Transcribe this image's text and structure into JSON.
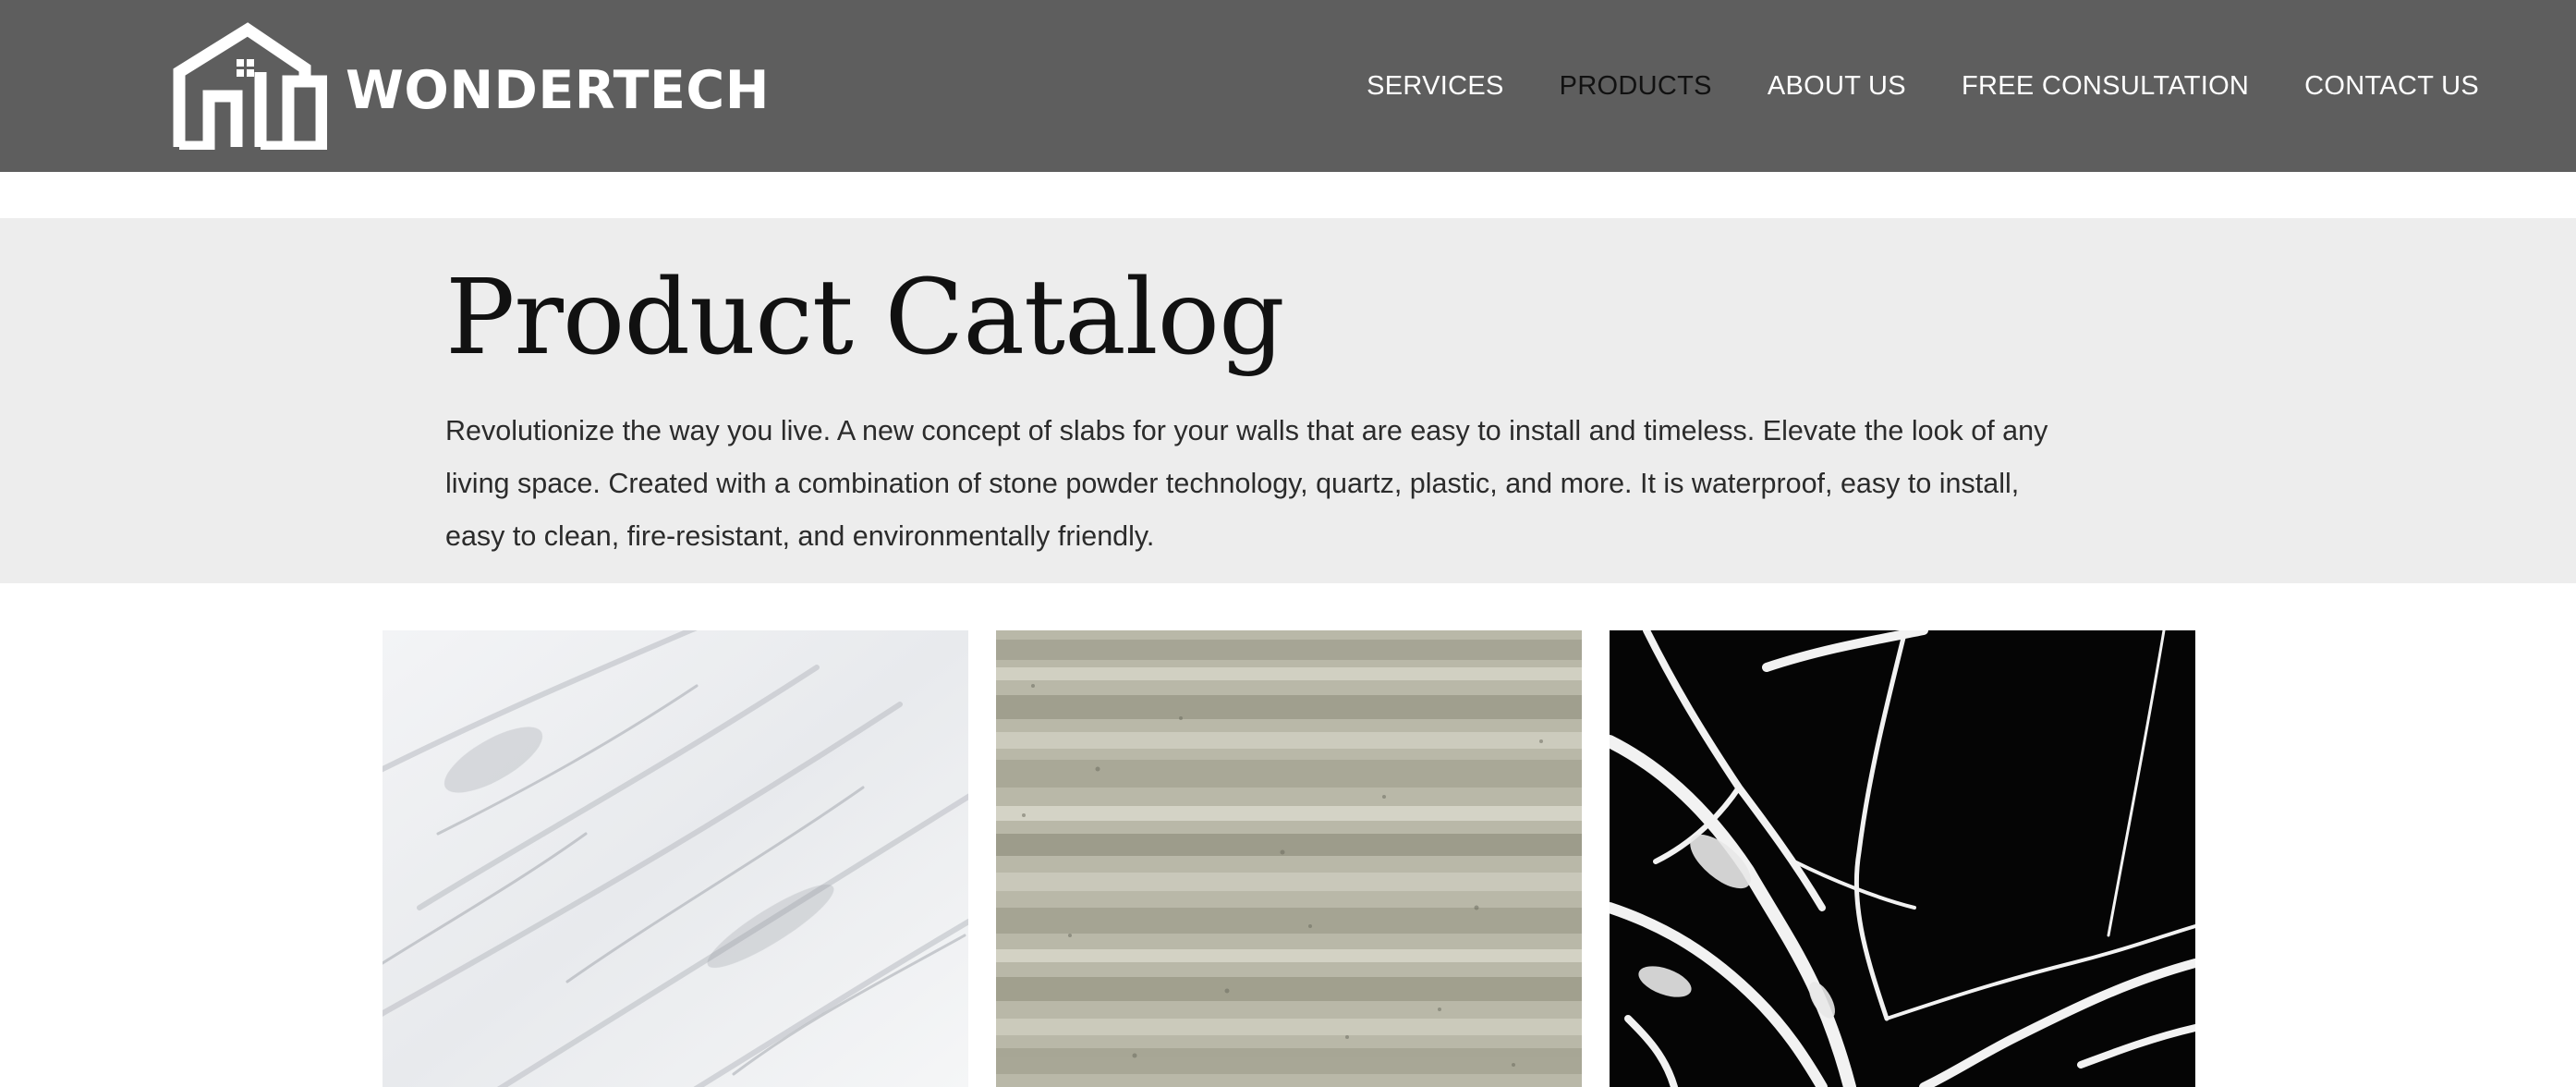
{
  "brand": {
    "name": "WONDERTECH",
    "logo_icon": "house-icon"
  },
  "nav": {
    "items": [
      {
        "label": "SERVICES",
        "active": false
      },
      {
        "label": "PRODUCTS",
        "active": true
      },
      {
        "label": "ABOUT US",
        "active": false
      },
      {
        "label": "FREE CONSULTATION",
        "active": false
      },
      {
        "label": "CONTACT US",
        "active": false
      }
    ]
  },
  "hero": {
    "title": "Product Catalog",
    "description": "Revolutionize the way you live. A new concept of slabs for your walls that are easy to install and timeless. Elevate the look of any living space. Created with a combination of stone powder technology, quartz, plastic, and more.  It is waterproof, easy to install, easy to clean, fire-resistant, and environmentally friendly."
  },
  "products": [
    {
      "swatch": "white-marble",
      "color": "#eef0f2"
    },
    {
      "swatch": "beige-travertine",
      "color": "#b7b6a6"
    },
    {
      "swatch": "black-marble",
      "color": "#050505"
    }
  ],
  "colors": {
    "header_bg": "#5e5e5e",
    "hero_bg": "#ededed",
    "nav_text": "#ffffff",
    "nav_active": "#111111"
  }
}
